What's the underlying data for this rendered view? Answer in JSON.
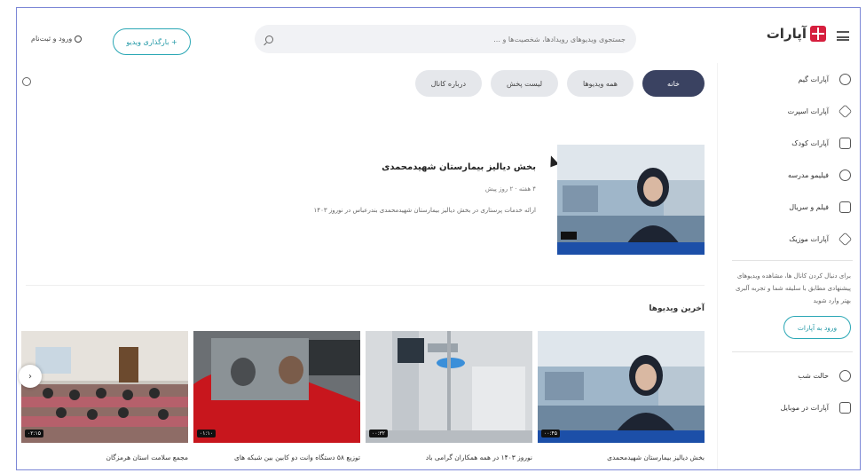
{
  "header": {
    "logo_text": "آپارات",
    "search_placeholder": "جستجوی ویدیوهای رویدادها، شخصیت‌ها و ...",
    "upload_label": "+ بارگذاری ویدیو",
    "login_label": "ورود و ثبت‌نام"
  },
  "sidebar": {
    "items": [
      {
        "label": "آپارات گیم",
        "icon": "gamepad-icon"
      },
      {
        "label": "آپارات اسپرت",
        "icon": "sport-icon"
      },
      {
        "label": "آپارات کودک",
        "icon": "kids-icon"
      },
      {
        "label": "فیلیمو مدرسه",
        "icon": "school-icon"
      },
      {
        "label": "فیلم و سریال",
        "icon": "film-icon"
      },
      {
        "label": "آپارات موزیک",
        "icon": "music-icon"
      }
    ],
    "note": "برای دنبال کردن کانال ها، مشاهده ویدیوهای پیشنهادی مطابق با سلیقه شما و تجربه آلبری بهتر وارد شوید",
    "login_button": "ورود به آپارات",
    "night_mode": "حالت شب",
    "mobile": "آپارات در موبایل"
  },
  "tabs": [
    "خانه",
    "همه ویدیوها",
    "لیست پخش",
    "درباره کانال"
  ],
  "featured": {
    "title": "بخش دیالیز بیمارستان شهیدمحمدی",
    "meta": "۴ هفته · ۲ روز پیش",
    "description": "ارائه خدمات پرستاری در بخش دیالیز بیمارستان شهیدمحمدی بندرعباس در نوروز ۱۴۰۳"
  },
  "latest": {
    "title": "آخرین ویدیوها",
    "cards": [
      {
        "title": "بخش دیالیز بیمارستان شهیدمحمدی"
      },
      {
        "title": "نوروز ۱۴۰۳ در همه همکاران گرامی باد"
      },
      {
        "title": "توزیع ۵۸ دستگاه وانت دو کابین بین شبکه های"
      },
      {
        "title": "مجمع سلامت استان هرمزگان"
      }
    ]
  }
}
